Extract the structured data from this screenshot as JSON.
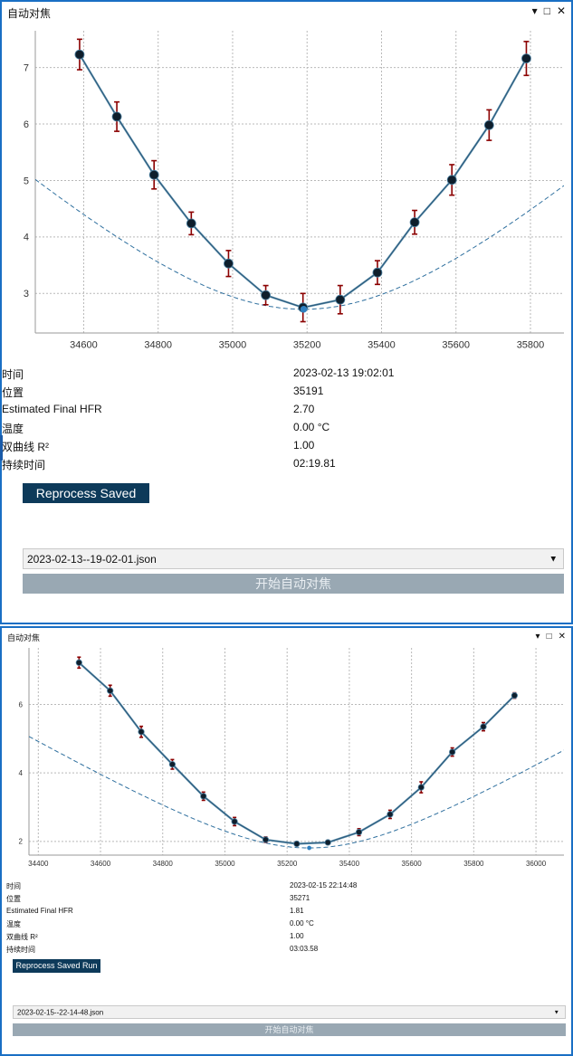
{
  "windows": [
    {
      "title": "自动对焦",
      "controls": [
        "▾",
        "□",
        "✕"
      ],
      "chart_data": {
        "type": "scatter",
        "title": "",
        "xlabel": "",
        "ylabel": "",
        "xlim": [
          34470,
          35890
        ],
        "ylim": [
          2.3,
          7.65
        ],
        "xticks": [
          34600,
          34800,
          35000,
          35200,
          35400,
          35600,
          35800
        ],
        "yticks": [
          3,
          4,
          5,
          6,
          7
        ],
        "grid": true,
        "series": [
          {
            "x": [
              34589,
              34689,
              34789,
              34889,
              34989,
              35089,
              35189,
              35289,
              35389,
              35489,
              35589,
              35689,
              35789
            ],
            "y": [
              7.23,
              6.13,
              5.1,
              4.24,
              3.53,
              2.97,
              2.75,
              2.89,
              3.37,
              4.26,
              5.01,
              5.98,
              7.16
            ],
            "err": [
              0.27,
              0.26,
              0.25,
              0.2,
              0.23,
              0.17,
              0.25,
              0.25,
              0.21,
              0.21,
              0.27,
              0.27,
              0.3
            ]
          }
        ],
        "fit_vertex": [
          35191,
          2.72
        ],
        "fit_b": 0.00215
      },
      "info": [
        {
          "label": "时间",
          "value": "2023-02-13 19:02:01"
        },
        {
          "label": "位置",
          "value": "35191"
        },
        {
          "label": "Estimated Final HFR",
          "value": "2.70"
        },
        {
          "label": "温度",
          "value": "0.00 °C"
        },
        {
          "label": "双曲线 R²",
          "value": "1.00"
        },
        {
          "label": "持续时间",
          "value": "02:19.81"
        }
      ],
      "reprocess_label": "Reprocess Saved Run",
      "file_select": "2023-02-13--19-02-01.json",
      "start_label": "开始自动对焦"
    },
    {
      "title": "自动对焦",
      "controls": [
        "▾",
        "□",
        "✕"
      ],
      "chart_data": {
        "type": "scatter",
        "title": "",
        "xlabel": "",
        "ylabel": "",
        "xlim": [
          34370,
          36090
        ],
        "ylim": [
          1.6,
          7.65
        ],
        "xticks": [
          34400,
          34600,
          34800,
          35000,
          35200,
          35400,
          35600,
          35800,
          36000
        ],
        "yticks": [
          2,
          4,
          6
        ],
        "grid": true,
        "series": [
          {
            "x": [
              34531,
              34631,
              34731,
              34831,
              34931,
              35031,
              35131,
              35231,
              35331,
              35431,
              35531,
              35631,
              35731,
              35831,
              35931
            ],
            "y": [
              7.22,
              6.4,
              5.2,
              4.25,
              3.32,
              2.58,
              2.05,
              1.93,
              1.97,
              2.27,
              2.79,
              3.58,
              4.61,
              5.35,
              6.26
            ],
            "err": [
              0.16,
              0.16,
              0.16,
              0.14,
              0.12,
              0.12,
              0.08,
              0.06,
              0.06,
              0.1,
              0.12,
              0.16,
              0.12,
              0.12,
              0.08
            ]
          }
        ],
        "fit_vertex": [
          35271,
          1.81
        ],
        "fit_b": 0.0029
      },
      "info": [
        {
          "label": "时间",
          "value": "2023-02-15 22:14:48"
        },
        {
          "label": "位置",
          "value": "35271"
        },
        {
          "label": "Estimated Final HFR",
          "value": "1.81"
        },
        {
          "label": "温度",
          "value": "0.00 °C"
        },
        {
          "label": "双曲线 R²",
          "value": "1.00"
        },
        {
          "label": "持续时间",
          "value": "03:03.58"
        }
      ],
      "reprocess_label": "Reprocess Saved Run",
      "file_select": "2023-02-15--22-14-48.json",
      "start_label": "开始自动对焦"
    }
  ]
}
